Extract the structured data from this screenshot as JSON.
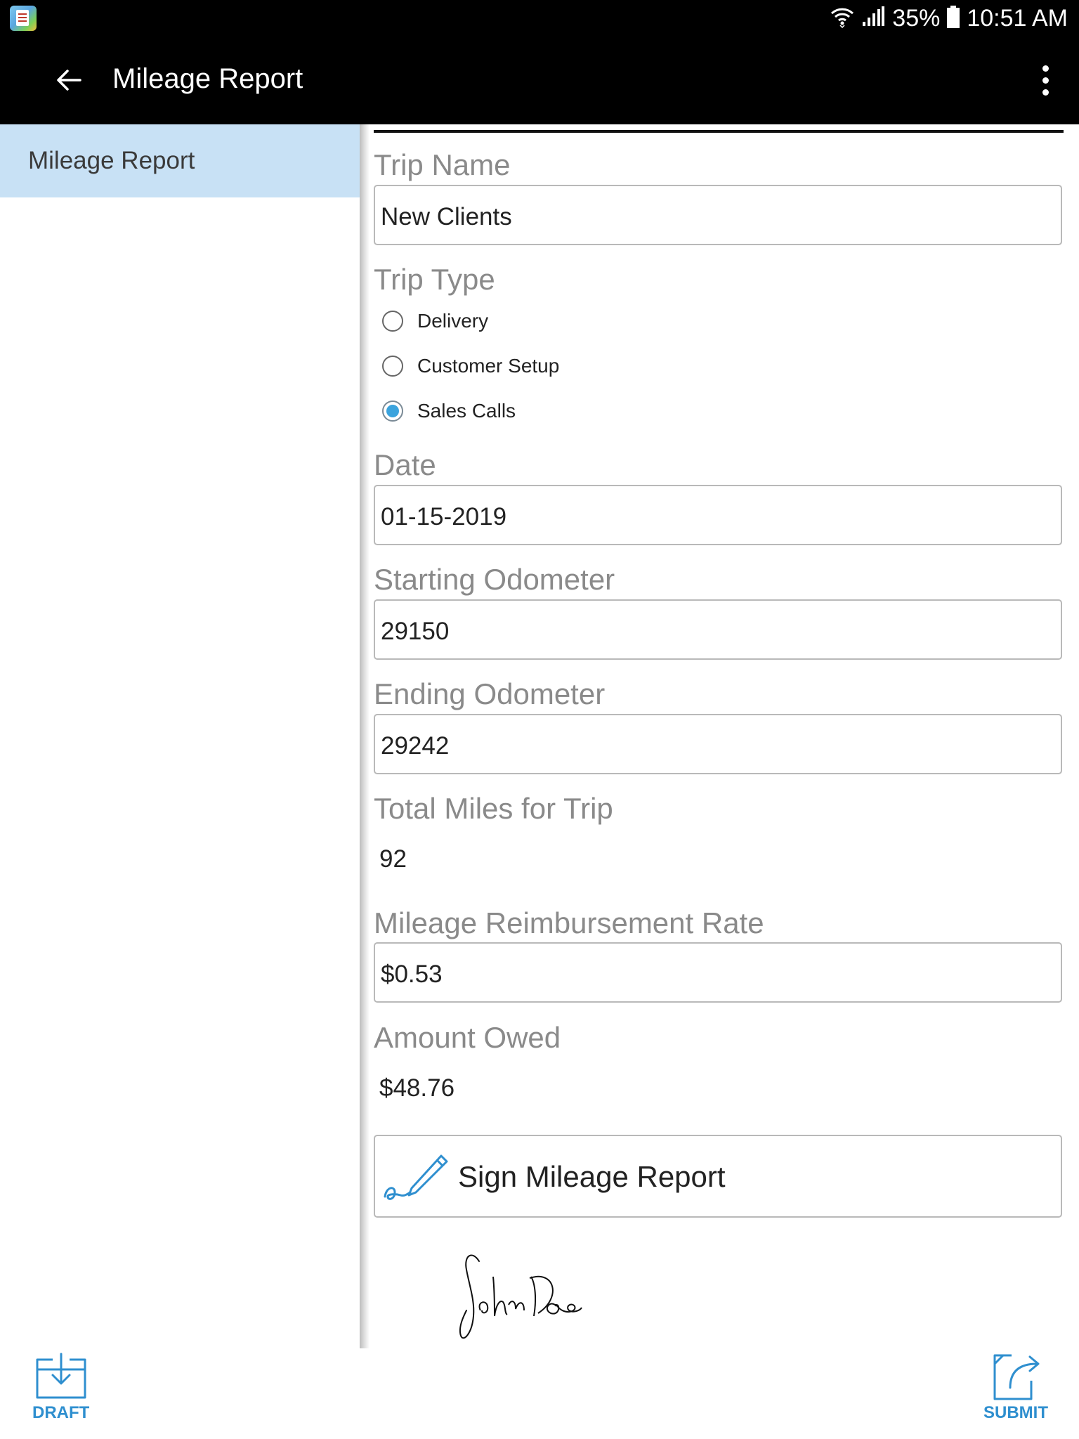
{
  "status_bar": {
    "battery": "35%",
    "time": "10:51 AM"
  },
  "app_bar": {
    "title": "Mileage Report"
  },
  "sidebar": {
    "items": [
      {
        "label": "Mileage Report",
        "selected": true
      }
    ]
  },
  "form": {
    "trip_name": {
      "label": "Trip Name",
      "value": "New Clients"
    },
    "trip_type": {
      "label": "Trip Type",
      "options": [
        "Delivery",
        "Customer Setup",
        "Sales Calls"
      ],
      "selected": "Sales Calls"
    },
    "date": {
      "label": "Date",
      "value": "01-15-2019"
    },
    "starting_odometer": {
      "label": "Starting Odometer",
      "value": "29150"
    },
    "ending_odometer": {
      "label": "Ending Odometer",
      "value": "29242"
    },
    "total_miles": {
      "label": "Total Miles for Trip",
      "value": "92"
    },
    "reimbursement_rate": {
      "label": "Mileage Reimbursement Rate",
      "value": "$0.53"
    },
    "amount_owed": {
      "label": "Amount Owed",
      "value": "$48.76"
    },
    "sign_button": {
      "label": "Sign Mileage Report"
    },
    "signature": {
      "text": "John Doe"
    }
  },
  "bottom_bar": {
    "draft_label": "DRAFT",
    "submit_label": "SUBMIT"
  },
  "colors": {
    "accent": "#2f8fcf",
    "radio_selected": "#3aa3dd",
    "sidebar_selected_bg": "#c8e1f5",
    "bar_bg": "#000000"
  }
}
